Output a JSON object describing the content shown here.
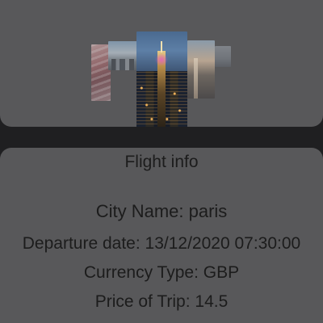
{
  "gallery": {
    "photos": [
      {
        "name": "eiffel-tower"
      },
      {
        "name": "paris-skyline"
      },
      {
        "name": "new-york-night"
      },
      {
        "name": "empire-state-building"
      },
      {
        "name": "city-view"
      }
    ]
  },
  "flight_info": {
    "title": "Flight info",
    "city_line": "City Name: paris",
    "departure_line": "Departure date: 13/12/2020 07:30:00",
    "currency_line": "Currency Type: GBP",
    "price_line": "Price of Trip: 14.5"
  },
  "colors": {
    "background": "#1f1f21",
    "card": "#58585a",
    "text": "#1c1c1c"
  }
}
